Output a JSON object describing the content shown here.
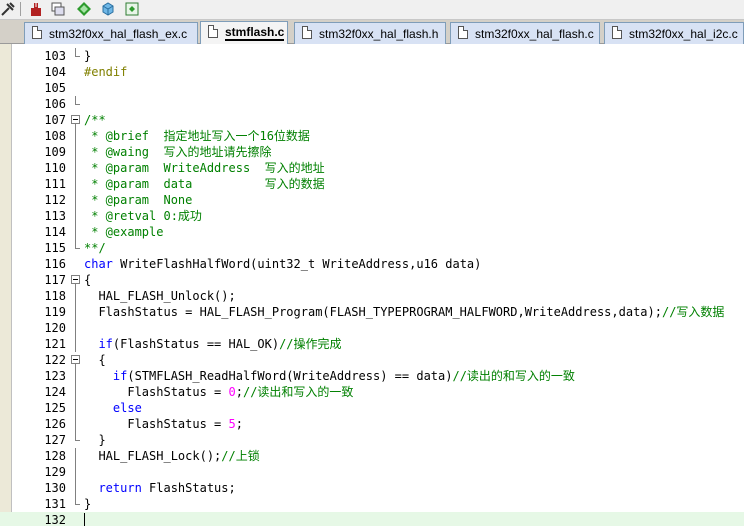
{
  "toolbar": {
    "buttons": [
      {
        "icon": "build-target-icon"
      },
      {
        "icon": "load-download-icon"
      },
      {
        "icon": "windows-icon"
      },
      {
        "icon": "debug-diamond-icon"
      },
      {
        "icon": "manage-components-icon"
      },
      {
        "icon": "pack-installer-icon"
      }
    ]
  },
  "tabs": [
    {
      "label": "stm32f0xx_hal_flash_ex.c",
      "active": false
    },
    {
      "label": "stmflash.c",
      "active": true
    },
    {
      "label": "stm32f0xx_hal_flash.h",
      "active": false
    },
    {
      "label": "stm32f0xx_hal_flash.c",
      "active": false
    },
    {
      "label": "stm32f0xx_hal_i2c.c",
      "active": false
    }
  ],
  "editor": {
    "current_line": "132",
    "colors": {
      "keyword": "#0000ff",
      "comment": "#008000",
      "preprocessor": "#808000",
      "number": "#ff00ff",
      "current_line_bg": "#e6f8e6"
    },
    "lines": [
      {
        "n": "103",
        "fold": "end",
        "segs": [
          {
            "t": "}",
            "k": "p"
          }
        ]
      },
      {
        "n": "104",
        "fold": "",
        "segs": [
          {
            "t": "#endif",
            "k": "pp"
          }
        ]
      },
      {
        "n": "105",
        "fold": "",
        "segs": []
      },
      {
        "n": "106",
        "fold": "end",
        "segs": []
      },
      {
        "n": "107",
        "fold": "open",
        "segs": [
          {
            "t": "/**",
            "k": "c"
          }
        ]
      },
      {
        "n": "108",
        "fold": "line",
        "segs": [
          {
            "t": " * @brief  指定地址写入一个16位数据",
            "k": "c"
          }
        ]
      },
      {
        "n": "109",
        "fold": "line",
        "segs": [
          {
            "t": " * @waing  写入的地址请先擦除",
            "k": "c"
          }
        ]
      },
      {
        "n": "110",
        "fold": "line",
        "segs": [
          {
            "t": " * @param  WriteAddress  写入的地址",
            "k": "c"
          }
        ]
      },
      {
        "n": "111",
        "fold": "line",
        "segs": [
          {
            "t": " * @param  data          写入的数据",
            "k": "c"
          }
        ]
      },
      {
        "n": "112",
        "fold": "line",
        "segs": [
          {
            "t": " * @param  None",
            "k": "c"
          }
        ]
      },
      {
        "n": "113",
        "fold": "line",
        "segs": [
          {
            "t": " * @retval 0:成功",
            "k": "c"
          }
        ]
      },
      {
        "n": "114",
        "fold": "line",
        "segs": [
          {
            "t": " * @example",
            "k": "c"
          }
        ]
      },
      {
        "n": "115",
        "fold": "end",
        "segs": [
          {
            "t": "**/",
            "k": "c"
          }
        ]
      },
      {
        "n": "116",
        "fold": "",
        "segs": [
          {
            "t": "char",
            "k": "kw"
          },
          {
            "t": " WriteFlashHalfWord(uint32_t WriteAddress,u16 data)",
            "k": "p"
          }
        ]
      },
      {
        "n": "117",
        "fold": "open",
        "segs": [
          {
            "t": "{",
            "k": "p"
          }
        ]
      },
      {
        "n": "118",
        "fold": "line",
        "segs": [
          {
            "t": "  HAL_FLASH_Unlock();",
            "k": "p"
          }
        ]
      },
      {
        "n": "119",
        "fold": "line",
        "segs": [
          {
            "t": "  FlashStatus = HAL_FLASH_Program(FLASH_TYPEPROGRAM_HALFWORD,WriteAddress,data);",
            "k": "p"
          },
          {
            "t": "//写入数据",
            "k": "c"
          }
        ]
      },
      {
        "n": "120",
        "fold": "line",
        "segs": []
      },
      {
        "n": "121",
        "fold": "line",
        "segs": [
          {
            "t": "  ",
            "k": "p"
          },
          {
            "t": "if",
            "k": "kw"
          },
          {
            "t": "(FlashStatus == HAL_OK)",
            "k": "p"
          },
          {
            "t": "//操作完成",
            "k": "c"
          }
        ]
      },
      {
        "n": "122",
        "fold": "open",
        "segs": [
          {
            "t": "  {",
            "k": "p"
          }
        ]
      },
      {
        "n": "123",
        "fold": "line",
        "segs": [
          {
            "t": "    ",
            "k": "p"
          },
          {
            "t": "if",
            "k": "kw"
          },
          {
            "t": "(STMFLASH_ReadHalfWord(WriteAddress) == data)",
            "k": "p"
          },
          {
            "t": "//读出的和写入的一致",
            "k": "c"
          }
        ]
      },
      {
        "n": "124",
        "fold": "line",
        "segs": [
          {
            "t": "      FlashStatus = ",
            "k": "p"
          },
          {
            "t": "0",
            "k": "num"
          },
          {
            "t": ";",
            "k": "p"
          },
          {
            "t": "//读出和写入的一致",
            "k": "c"
          }
        ]
      },
      {
        "n": "125",
        "fold": "line",
        "segs": [
          {
            "t": "    ",
            "k": "p"
          },
          {
            "t": "else",
            "k": "kw"
          }
        ]
      },
      {
        "n": "126",
        "fold": "line",
        "segs": [
          {
            "t": "      FlashStatus = ",
            "k": "p"
          },
          {
            "t": "5",
            "k": "num"
          },
          {
            "t": ";",
            "k": "p"
          }
        ]
      },
      {
        "n": "127",
        "fold": "end",
        "segs": [
          {
            "t": "  }",
            "k": "p"
          }
        ]
      },
      {
        "n": "128",
        "fold": "line",
        "segs": [
          {
            "t": "  HAL_FLASH_Lock();",
            "k": "p"
          },
          {
            "t": "//上锁",
            "k": "c"
          }
        ]
      },
      {
        "n": "129",
        "fold": "line",
        "segs": []
      },
      {
        "n": "130",
        "fold": "line",
        "segs": [
          {
            "t": "  ",
            "k": "p"
          },
          {
            "t": "return",
            "k": "kw"
          },
          {
            "t": " FlashStatus;",
            "k": "p"
          }
        ]
      },
      {
        "n": "131",
        "fold": "end",
        "segs": [
          {
            "t": "}",
            "k": "p"
          }
        ]
      },
      {
        "n": "132",
        "fold": "",
        "segs": []
      }
    ]
  }
}
